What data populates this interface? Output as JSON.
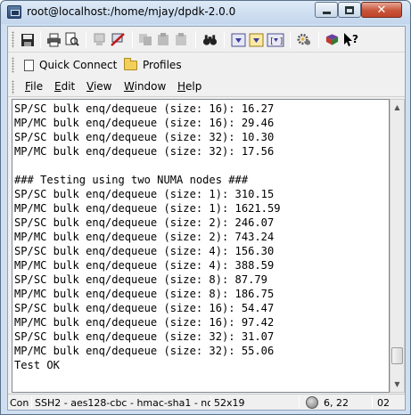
{
  "window": {
    "title": "root@localhost:/home/mjay/dpdk-2.0.0"
  },
  "quickbar": {
    "quick_connect": "Quick Connect",
    "profiles": "Profiles"
  },
  "menu": [
    {
      "key": "F",
      "rest": "ile"
    },
    {
      "key": "E",
      "rest": "dit"
    },
    {
      "key": "V",
      "rest": "iew"
    },
    {
      "key": "W",
      "rest": "indow"
    },
    {
      "key": "H",
      "rest": "elp"
    }
  ],
  "terminal": {
    "lines": [
      "SP/SC bulk enq/dequeue (size: 16): 16.27",
      "MP/MC bulk enq/dequeue (size: 16): 29.46",
      "SP/SC bulk enq/dequeue (size: 32): 10.30",
      "MP/MC bulk enq/dequeue (size: 32): 17.56",
      "",
      "### Testing using two NUMA nodes ###",
      "SP/SC bulk enq/dequeue (size: 1): 310.15",
      "MP/MC bulk enq/dequeue (size: 1): 1621.59",
      "SP/SC bulk enq/dequeue (size: 2): 246.07",
      "MP/MC bulk enq/dequeue (size: 2): 743.24",
      "SP/SC bulk enq/dequeue (size: 4): 156.30",
      "MP/MC bulk enq/dequeue (size: 4): 388.59",
      "SP/SC bulk enq/dequeue (size: 8): 87.79",
      "MP/MC bulk enq/dequeue (size: 8): 186.75",
      "SP/SC bulk enq/dequeue (size: 16): 54.47",
      "MP/MC bulk enq/dequeue (size: 16): 97.42",
      "SP/SC bulk enq/dequeue (size: 32): 31.07",
      "MP/MC bulk enq/dequeue (size: 32): 55.06",
      "Test OK"
    ]
  },
  "scrollbar": {
    "position_fraction": 0.95
  },
  "status": {
    "connection": "Con",
    "cipher": "SSH2 - aes128-cbc - hmac-sha1 - no",
    "size": "52x19",
    "cursor": "6, 22",
    "extra": "02"
  },
  "colors": {
    "title_bg": "#cfdff0",
    "close_button": "#c8553a",
    "terminal_bg": "#ffffff",
    "terminal_fg": "#000000"
  }
}
